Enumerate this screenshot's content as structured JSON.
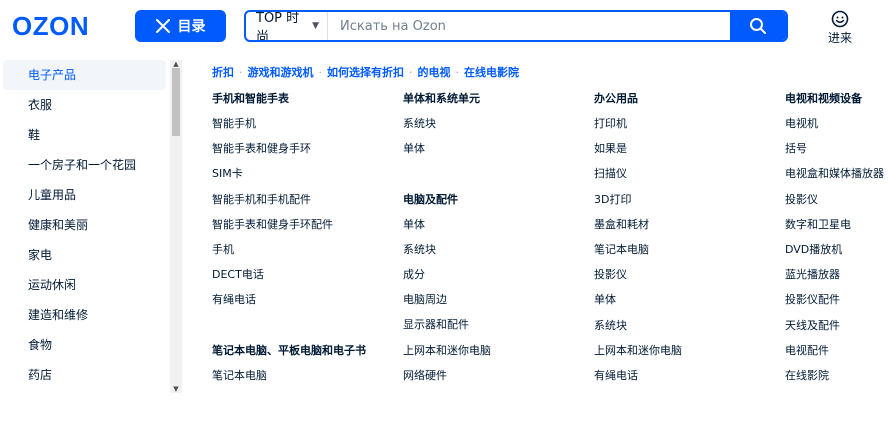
{
  "header": {
    "logo": "OZON",
    "catalog_label": "目录",
    "search_category": "TOP 时尚",
    "search_placeholder": "Искать на Ozon",
    "login_label": "进来"
  },
  "sidebar": {
    "items": [
      {
        "label": "电子产品",
        "active": true
      },
      {
        "label": "衣服"
      },
      {
        "label": "鞋"
      },
      {
        "label": "一个房子和一个花园"
      },
      {
        "label": "儿童用品"
      },
      {
        "label": "健康和美丽"
      },
      {
        "label": "家电"
      },
      {
        "label": "运动休闲"
      },
      {
        "label": "建造和维修"
      },
      {
        "label": "食物"
      },
      {
        "label": "药店"
      }
    ]
  },
  "tags": [
    "折扣",
    "游戏和游戏机",
    "如何选择有折扣",
    "的电视",
    "在线电影院"
  ],
  "columns": [
    {
      "groups": [
        {
          "title": "手机和智能手表",
          "items": [
            "智能手机",
            "智能手表和健身手环",
            "SIM卡",
            "智能手机和手机配件",
            "智能手表和健身手环配件",
            "手机",
            "DECT电话",
            "有绳电话"
          ]
        },
        {
          "title": "笔记本电脑、平板电脑和电子书",
          "items": [
            "笔记本电脑"
          ]
        }
      ]
    },
    {
      "groups": [
        {
          "title": "单体和系统单元",
          "items": [
            "系统块",
            "单体"
          ]
        },
        {
          "title": "电脑及配件",
          "items": [
            "单体",
            "系统块",
            "成分",
            "电脑周边",
            "显示器和配件",
            "上网本和迷你电脑",
            "网络硬件"
          ]
        }
      ]
    },
    {
      "groups": [
        {
          "title": "办公用品",
          "items": [
            "打印机",
            "如果是",
            "扫描仪",
            "3D打印",
            "墨盒和耗材",
            "笔记本电脑",
            "投影仪",
            "单体",
            "系统块",
            "上网本和迷你电脑",
            "有绳电话"
          ]
        }
      ]
    },
    {
      "groups": [
        {
          "title": "电视和视频设备",
          "items": [
            "电视机",
            "括号",
            "电视盒和媒体播放器",
            "投影仪",
            "数字和卫星电",
            "DVD播放机",
            "蓝光播放器",
            "投影仪配件",
            "天线及配件",
            "电视配件",
            "在线影院"
          ]
        }
      ]
    }
  ],
  "colors": {
    "brand": "#005bff",
    "text": "#001a34"
  }
}
